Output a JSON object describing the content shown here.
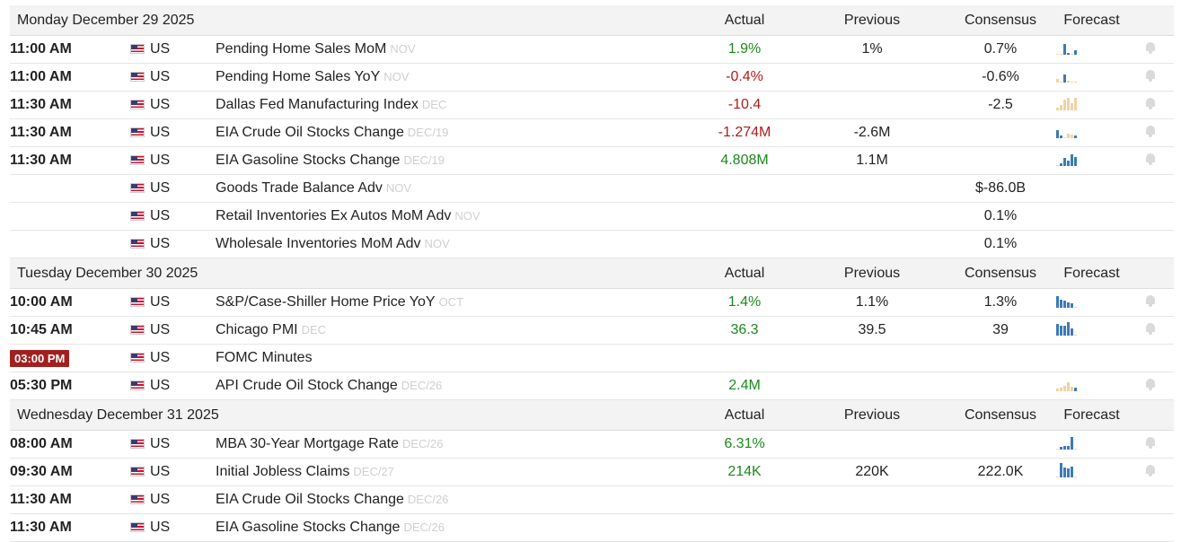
{
  "columns": {
    "actual": "Actual",
    "previous": "Previous",
    "consensus": "Consensus",
    "forecast": "Forecast"
  },
  "days": [
    {
      "date": "Monday December 29 2025",
      "events": [
        {
          "time": "11:00 AM",
          "country": "US",
          "name": "Pending Home Sales MoM",
          "period": "NOV",
          "actual": "",
          "previous": "1.9%",
          "prev_color": "pos",
          "consensus": "1%",
          "forecast": "0.7%",
          "spark": [
            {
              "h": 0,
              "c": "t"
            },
            {
              "h": 0,
              "c": "t"
            },
            {
              "h": 12,
              "c": "b"
            },
            {
              "h": 2,
              "c": "b"
            },
            {
              "h": 0,
              "c": "t"
            },
            {
              "h": 5,
              "c": "b"
            }
          ],
          "bell": true
        },
        {
          "time": "11:00 AM",
          "country": "US",
          "name": "Pending Home Sales YoY",
          "period": "NOV",
          "actual": "",
          "previous": "-0.4%",
          "prev_color": "neg",
          "consensus": "",
          "forecast": "-0.6%",
          "spark": [
            {
              "h": 4,
              "c": "t"
            },
            {
              "h": 0,
              "c": "t"
            },
            {
              "h": 9,
              "c": "b"
            },
            {
              "h": 2,
              "c": "t"
            },
            {
              "h": 0,
              "c": "t"
            },
            {
              "h": 0,
              "c": "t"
            }
          ],
          "bell": true
        },
        {
          "time": "11:30 AM",
          "country": "US",
          "name": "Dallas Fed Manufacturing Index",
          "period": "DEC",
          "actual": "",
          "previous": "-10.4",
          "prev_color": "neg",
          "consensus": "",
          "forecast": "-2.5",
          "spark": [
            {
              "h": 3,
              "c": "t"
            },
            {
              "h": 6,
              "c": "t"
            },
            {
              "h": 12,
              "c": "t"
            },
            {
              "h": 14,
              "c": "t"
            },
            {
              "h": 8,
              "c": "t"
            },
            {
              "h": 14,
              "c": "t"
            }
          ],
          "bell": true
        },
        {
          "time": "11:30 AM",
          "country": "US",
          "name": "EIA Crude Oil Stocks Change",
          "period": "DEC/19",
          "actual": "",
          "previous": "-1.274M",
          "prev_color": "neg",
          "consensus": "-2.6M",
          "forecast": "",
          "spark": [
            {
              "h": 9,
              "c": "b"
            },
            {
              "h": 3,
              "c": "b"
            },
            {
              "h": 0,
              "c": "t"
            },
            {
              "h": 5,
              "c": "t"
            },
            {
              "h": 4,
              "c": "t"
            },
            {
              "h": 3,
              "c": "b"
            }
          ],
          "bell": true
        },
        {
          "time": "11:30 AM",
          "country": "US",
          "name": "EIA Gasoline Stocks Change",
          "period": "DEC/19",
          "actual": "",
          "previous": "4.808M",
          "prev_color": "pos",
          "consensus": "1.1M",
          "forecast": "",
          "spark": [
            {
              "h": 0,
              "c": "t"
            },
            {
              "h": 3,
              "c": "b"
            },
            {
              "h": 9,
              "c": "b"
            },
            {
              "h": 6,
              "c": "b"
            },
            {
              "h": 13,
              "c": "b"
            },
            {
              "h": 10,
              "c": "b"
            }
          ],
          "bell": true
        },
        {
          "time": "",
          "country": "US",
          "name": "Goods Trade Balance Adv",
          "period": "NOV",
          "actual": "",
          "previous": "",
          "prev_color": "",
          "consensus": "",
          "forecast": "$-86.0B",
          "spark": [],
          "bell": false
        },
        {
          "time": "",
          "country": "US",
          "name": "Retail Inventories Ex Autos MoM Adv",
          "period": "NOV",
          "actual": "",
          "previous": "",
          "prev_color": "",
          "consensus": "",
          "forecast": "0.1%",
          "spark": [],
          "bell": false
        },
        {
          "time": "",
          "country": "US",
          "name": "Wholesale Inventories MoM Adv",
          "period": "NOV",
          "actual": "",
          "previous": "",
          "prev_color": "",
          "consensus": "",
          "forecast": "0.1%",
          "spark": [],
          "bell": false
        }
      ]
    },
    {
      "date": "Tuesday December 30 2025",
      "events": [
        {
          "time": "10:00 AM",
          "country": "US",
          "name": "S&P/Case-Shiller Home Price YoY",
          "period": "OCT",
          "actual": "",
          "previous": "1.4%",
          "prev_color": "pos",
          "consensus": "1.1%",
          "forecast": "1.3%",
          "spark": [
            {
              "h": 13,
              "c": "b"
            },
            {
              "h": 9,
              "c": "b"
            },
            {
              "h": 8,
              "c": "b"
            },
            {
              "h": 6,
              "c": "b"
            },
            {
              "h": 5,
              "c": "b"
            },
            {
              "h": 0,
              "c": "t"
            }
          ],
          "bell": true
        },
        {
          "time": "10:45 AM",
          "country": "US",
          "name": "Chicago PMI",
          "period": "DEC",
          "actual": "",
          "previous": "36.3",
          "prev_color": "pos",
          "consensus": "39.5",
          "forecast": "39",
          "spark": [
            {
              "h": 13,
              "c": "b"
            },
            {
              "h": 11,
              "c": "b"
            },
            {
              "h": 11,
              "c": "b"
            },
            {
              "h": 15,
              "c": "b"
            },
            {
              "h": 8,
              "c": "b"
            },
            {
              "h": 0,
              "c": "t"
            }
          ],
          "bell": true
        },
        {
          "time": "03:00 PM",
          "time_badge": true,
          "country": "US",
          "name": "FOMC Minutes",
          "period": "",
          "actual": "",
          "previous": "",
          "prev_color": "",
          "consensus": "",
          "forecast": "",
          "spark": [],
          "bell": false
        },
        {
          "time": "05:30 PM",
          "country": "US",
          "name": "API Crude Oil Stock Change",
          "period": "DEC/26",
          "actual": "",
          "previous": "2.4M",
          "prev_color": "pos",
          "consensus": "",
          "forecast": "",
          "spark": [
            {
              "h": 3,
              "c": "t"
            },
            {
              "h": 4,
              "c": "t"
            },
            {
              "h": 6,
              "c": "t"
            },
            {
              "h": 10,
              "c": "t"
            },
            {
              "h": 5,
              "c": "t"
            },
            {
              "h": 4,
              "c": "b"
            }
          ],
          "bell": true
        }
      ]
    },
    {
      "date": "Wednesday December 31 2025",
      "events": [
        {
          "time": "08:00 AM",
          "country": "US",
          "name": "MBA 30-Year Mortgage Rate",
          "period": "DEC/26",
          "actual": "",
          "previous": "6.31%",
          "prev_color": "pos",
          "consensus": "",
          "forecast": "",
          "spark": [
            {
              "h": 0,
              "c": "t"
            },
            {
              "h": 3,
              "c": "b"
            },
            {
              "h": 4,
              "c": "b"
            },
            {
              "h": 4,
              "c": "b"
            },
            {
              "h": 14,
              "c": "b"
            },
            {
              "h": 0,
              "c": "t"
            }
          ],
          "bell": true
        },
        {
          "time": "09:30 AM",
          "country": "US",
          "name": "Initial Jobless Claims",
          "period": "DEC/27",
          "actual": "",
          "previous": "214K",
          "prev_color": "pos",
          "consensus": "220K",
          "forecast": "222.0K",
          "spark": [
            {
              "h": 0,
              "c": "t"
            },
            {
              "h": 16,
              "c": "b"
            },
            {
              "h": 11,
              "c": "b"
            },
            {
              "h": 10,
              "c": "b"
            },
            {
              "h": 12,
              "c": "b"
            },
            {
              "h": 0,
              "c": "t"
            }
          ],
          "bell": true
        },
        {
          "time": "11:30 AM",
          "country": "US",
          "name": "EIA Crude Oil Stocks Change",
          "period": "DEC/26",
          "actual": "",
          "previous": "",
          "prev_color": "",
          "consensus": "",
          "forecast": "",
          "spark": [],
          "bell": false
        },
        {
          "time": "11:30 AM",
          "country": "US",
          "name": "EIA Gasoline Stocks Change",
          "period": "DEC/26",
          "actual": "",
          "previous": "",
          "prev_color": "",
          "consensus": "",
          "forecast": "",
          "spark": [],
          "bell": false
        }
      ]
    }
  ],
  "colors": {
    "positive": "#1a8a1a",
    "negative": "#b01c1c",
    "badge": "#a11f1f",
    "bar_blue": "#3d7ab8",
    "bar_tan": "#f2d2a2"
  },
  "icons": {
    "flag": "us-flag-icon",
    "bell": "bell-icon"
  }
}
